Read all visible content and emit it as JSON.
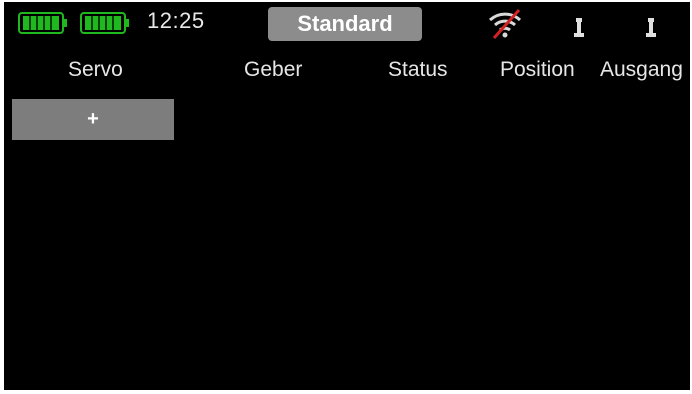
{
  "status_bar": {
    "battery_1": {
      "icon": "battery-full-icon",
      "level": 1.0,
      "color": "#1fb81f"
    },
    "battery_2": {
      "icon": "battery-full-icon",
      "level": 1.0,
      "color": "#1fb81f"
    },
    "time": "12:25",
    "model_name": "Standard",
    "signal": {
      "icon": "signal-crossed-icon",
      "state": "no-connection",
      "slash_color": "#d22222"
    },
    "receiver_1": {
      "icon": "receiver-icon"
    },
    "receiver_2": {
      "icon": "receiver-icon"
    }
  },
  "table": {
    "headers": [
      "Servo",
      "Geber",
      "Status",
      "Position",
      "Ausgang"
    ],
    "rows": []
  },
  "add_button": {
    "label": "+"
  },
  "colors": {
    "background": "#000000",
    "button_gray": "#7d7d7d",
    "header_text": "#e6e6e6",
    "battery_green": "#1fb81f"
  }
}
